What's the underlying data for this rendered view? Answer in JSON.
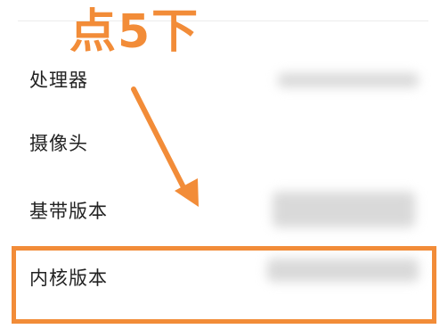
{
  "annotation": {
    "text": "点5下",
    "color": "#f28c38"
  },
  "settings_list": {
    "items": [
      {
        "label": "处理器"
      },
      {
        "label": "摄像头"
      },
      {
        "label": "基带版本"
      },
      {
        "label": "内核版本"
      }
    ]
  },
  "colors": {
    "accent": "#f28c38",
    "text": "#222222",
    "redaction": "#d9d9d9"
  },
  "icons": {
    "arrow": "down-right-arrow-icon"
  }
}
